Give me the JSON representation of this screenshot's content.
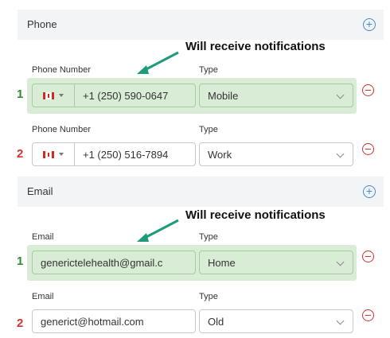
{
  "phone_section": {
    "title": "Phone",
    "add_icon": "plus-circle-icon",
    "note": "Will receive notifications",
    "rows": [
      {
        "index": "1",
        "number_label": "Phone Number",
        "type_label": "Type",
        "country_flag": "canada-flag",
        "number": "+1 (250) 590-0647",
        "type": "Mobile",
        "highlighted": true
      },
      {
        "index": "2",
        "number_label": "Phone Number",
        "type_label": "Type",
        "country_flag": "canada-flag",
        "number": "+1 (250) 516-7894",
        "type": "Work",
        "highlighted": false
      }
    ]
  },
  "email_section": {
    "title": "Email",
    "add_icon": "plus-circle-icon",
    "note": "Will receive notifications",
    "rows": [
      {
        "index": "1",
        "email_label": "Email",
        "type_label": "Type",
        "email": "generictelehealth@gmail.c",
        "type": "Home",
        "highlighted": true
      },
      {
        "index": "2",
        "email_label": "Email",
        "type_label": "Type",
        "email": "generict@hotmail.com",
        "type": "Old",
        "highlighted": false
      }
    ]
  },
  "colors": {
    "highlight": "#d9ecd6",
    "accent_blue": "#3e8ed0",
    "remove_red": "#d0342c",
    "arrow_teal": "#1f9a7a",
    "primary_green": "#2e8b2e"
  }
}
